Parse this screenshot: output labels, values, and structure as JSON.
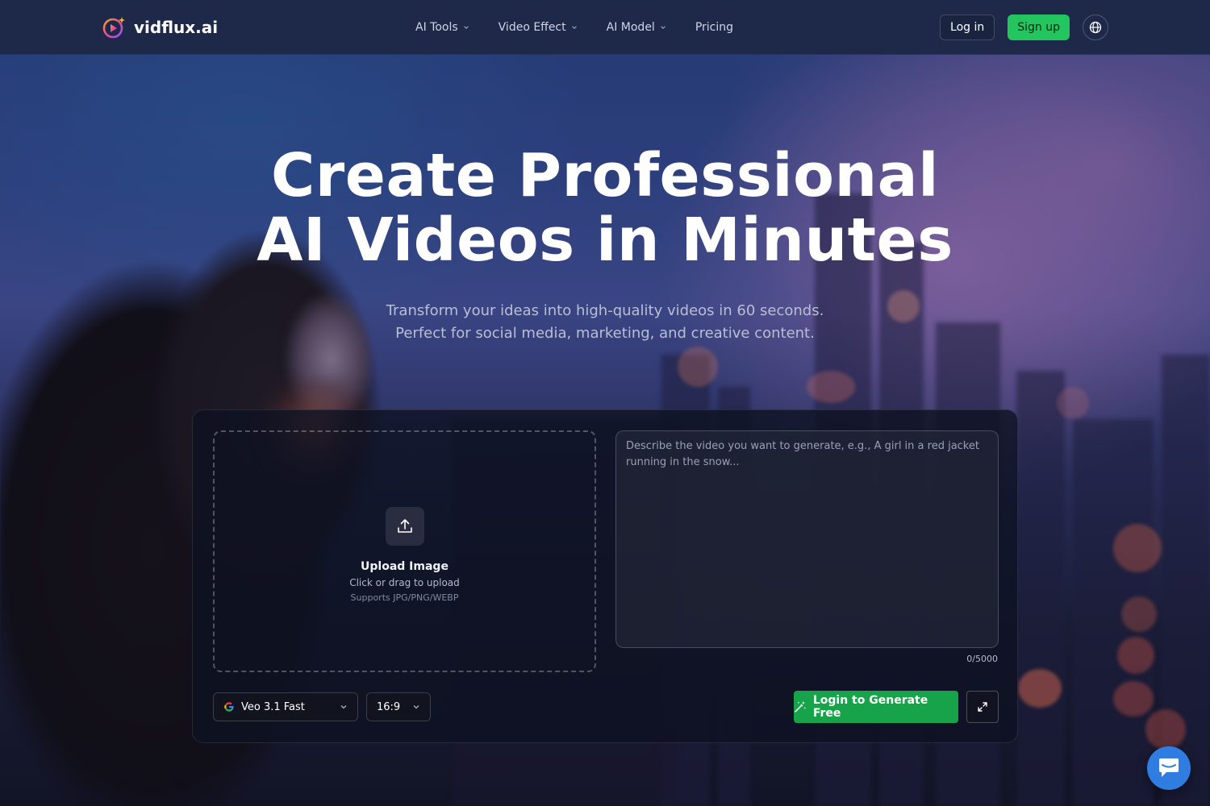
{
  "brand": {
    "name": "vidflux.ai",
    "logo_icon": "play-spark-logo"
  },
  "nav": {
    "items": [
      {
        "label": "AI Tools",
        "has_dropdown": true
      },
      {
        "label": "Video Effect",
        "has_dropdown": true
      },
      {
        "label": "AI Model",
        "has_dropdown": true
      },
      {
        "label": "Pricing",
        "has_dropdown": false
      }
    ],
    "login_label": "Log in",
    "signup_label": "Sign up",
    "language_icon": "globe-icon"
  },
  "hero": {
    "title_line1": "Create Professional",
    "title_line2": "AI Videos in Minutes",
    "subtitle_line1": "Transform your ideas into high-quality videos in 60 seconds.",
    "subtitle_line2": "Perfect for social media, marketing, and creative content."
  },
  "generator": {
    "upload": {
      "title": "Upload Image",
      "hint": "Click or drag to upload",
      "formats": "Supports JPG/PNG/WEBP",
      "icon": "upload-icon"
    },
    "prompt": {
      "placeholder": "Describe the video you want to generate, e.g., A girl in a red jacket running in the snow...",
      "value": "",
      "counter": "0/5000"
    },
    "model_select": {
      "value": "Veo 3.1 Fast",
      "icon": "google-g-icon"
    },
    "ratio_select": {
      "value": "16:9"
    },
    "generate_label": "Login to Generate Free",
    "generate_icon": "magic-wand-icon",
    "expand_icon": "expand-icon"
  },
  "chat": {
    "icon": "chat-bubble-icon"
  },
  "colors": {
    "accent_green": "#22c55e",
    "generate_green": "#16a34a",
    "navbar_bg": "#1e2849",
    "chat_blue": "#2f7de1"
  }
}
